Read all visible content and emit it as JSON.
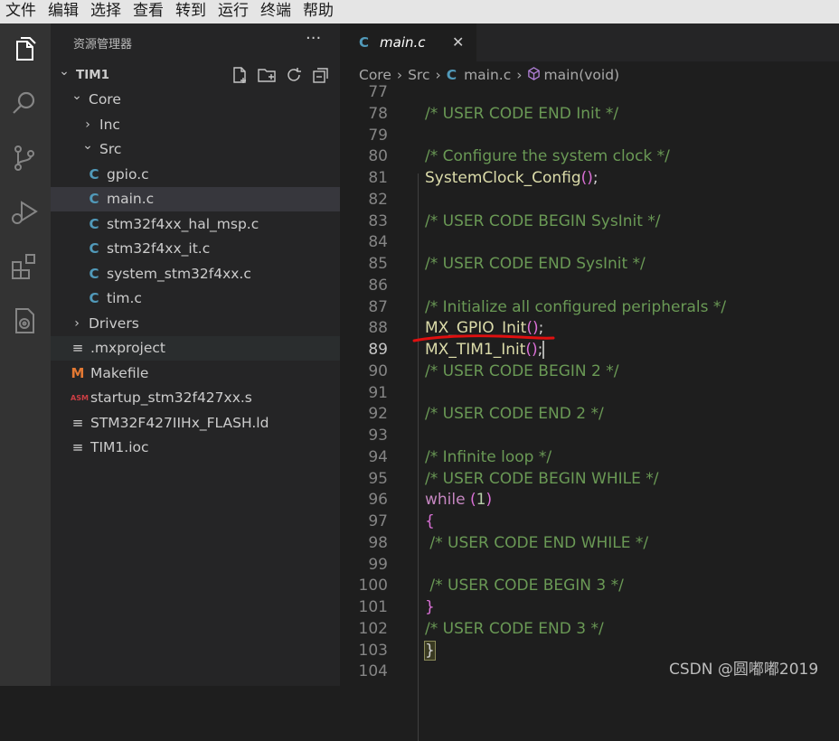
{
  "menubar": {
    "items": [
      "文件",
      "编辑",
      "选择",
      "查看",
      "转到",
      "运行",
      "终端",
      "帮助"
    ]
  },
  "activitybar": {
    "icons": [
      "files-icon",
      "search-icon",
      "source-control-icon",
      "run-debug-icon",
      "extensions-icon",
      "stm32-extension-icon"
    ]
  },
  "sidebar": {
    "title": "资源管理器",
    "more": "···",
    "tree": [
      {
        "label": "TIM1",
        "kind": "root"
      },
      {
        "label": "Core",
        "kind": "folder-open"
      },
      {
        "label": "Inc",
        "kind": "folder-closed"
      },
      {
        "label": "Src",
        "kind": "folder-open"
      },
      {
        "label": "gpio.c",
        "kind": "c"
      },
      {
        "label": "main.c",
        "kind": "c",
        "selected": true
      },
      {
        "label": "stm32f4xx_hal_msp.c",
        "kind": "c"
      },
      {
        "label": "stm32f4xx_it.c",
        "kind": "c"
      },
      {
        "label": "system_stm32f4xx.c",
        "kind": "c"
      },
      {
        "label": "tim.c",
        "kind": "c"
      },
      {
        "label": "Drivers",
        "kind": "folder-closed"
      },
      {
        "label": ".mxproject",
        "kind": "text",
        "hover": true
      },
      {
        "label": "Makefile",
        "kind": "make"
      },
      {
        "label": "startup_stm32f427xx.s",
        "kind": "asm"
      },
      {
        "label": "STM32F427IIHx_FLASH.ld",
        "kind": "text"
      },
      {
        "label": "TIM1.ioc",
        "kind": "text"
      }
    ],
    "icon_glyphs": {
      "c": "C",
      "make": "M",
      "asm": "ASM",
      "text": "≡"
    }
  },
  "editor": {
    "tab": {
      "icon": "C",
      "label": "main.c",
      "close": "✕"
    },
    "breadcrumb": {
      "parts": [
        "Core",
        "Src",
        "main.c",
        "main(void)"
      ],
      "file_icon": "C"
    },
    "lines": [
      {
        "n": "77",
        "tokens": []
      },
      {
        "n": "78",
        "tokens": [
          {
            "t": "cmt",
            "v": "/* USER CODE END Init */"
          }
        ]
      },
      {
        "n": "79",
        "tokens": []
      },
      {
        "n": "80",
        "tokens": [
          {
            "t": "cmt",
            "v": "/* Configure the system clock */"
          }
        ]
      },
      {
        "n": "81",
        "tokens": [
          {
            "t": "fn",
            "v": "SystemClock_Config"
          },
          {
            "t": "paren",
            "v": "()"
          },
          {
            "t": "punc",
            "v": ";"
          }
        ]
      },
      {
        "n": "82",
        "tokens": []
      },
      {
        "n": "83",
        "tokens": [
          {
            "t": "cmt",
            "v": "/* USER CODE BEGIN SysInit */"
          }
        ]
      },
      {
        "n": "84",
        "tokens": []
      },
      {
        "n": "85",
        "tokens": [
          {
            "t": "cmt",
            "v": "/* USER CODE END SysInit */"
          }
        ]
      },
      {
        "n": "86",
        "tokens": []
      },
      {
        "n": "87",
        "tokens": [
          {
            "t": "cmt",
            "v": "/* Initialize all configured peripherals */"
          }
        ]
      },
      {
        "n": "88",
        "tokens": [
          {
            "t": "fn",
            "v": "MX_GPIO_Init"
          },
          {
            "t": "paren",
            "v": "()"
          },
          {
            "t": "punc",
            "v": ";"
          }
        ]
      },
      {
        "n": "89",
        "active": true,
        "tokens": [
          {
            "t": "fn",
            "v": "MX_TIM1_Init"
          },
          {
            "t": "paren",
            "v": "()"
          },
          {
            "t": "punc",
            "v": ";"
          },
          {
            "t": "cursor",
            "v": ""
          }
        ]
      },
      {
        "n": "90",
        "tokens": [
          {
            "t": "cmt",
            "v": "/* USER CODE BEGIN 2 */"
          }
        ]
      },
      {
        "n": "91",
        "tokens": []
      },
      {
        "n": "92",
        "tokens": [
          {
            "t": "cmt",
            "v": "/* USER CODE END 2 */"
          }
        ]
      },
      {
        "n": "93",
        "tokens": []
      },
      {
        "n": "94",
        "tokens": [
          {
            "t": "cmt",
            "v": "/* Infinite loop */"
          }
        ]
      },
      {
        "n": "95",
        "tokens": [
          {
            "t": "cmt",
            "v": "/* USER CODE BEGIN WHILE */"
          }
        ]
      },
      {
        "n": "96",
        "tokens": [
          {
            "t": "kw",
            "v": "while"
          },
          {
            "t": "punc",
            "v": " "
          },
          {
            "t": "paren",
            "v": "("
          },
          {
            "t": "num",
            "v": "1"
          },
          {
            "t": "paren",
            "v": ")"
          }
        ]
      },
      {
        "n": "97",
        "tokens": [
          {
            "t": "paren",
            "v": "{"
          }
        ]
      },
      {
        "n": "98",
        "tokens": [
          {
            "t": "punc",
            "v": " "
          },
          {
            "t": "cmt",
            "v": "/* USER CODE END WHILE */"
          }
        ]
      },
      {
        "n": "99",
        "tokens": []
      },
      {
        "n": "100",
        "tokens": [
          {
            "t": "punc",
            "v": " "
          },
          {
            "t": "cmt",
            "v": "/* USER CODE BEGIN 3 */"
          }
        ]
      },
      {
        "n": "101",
        "tokens": [
          {
            "t": "paren",
            "v": "}"
          }
        ]
      },
      {
        "n": "102",
        "tokens": [
          {
            "t": "cmt",
            "v": "/* USER CODE END 3 */"
          }
        ]
      },
      {
        "n": "103",
        "tokens": [
          {
            "t": "brace-gold",
            "v": "}"
          }
        ]
      },
      {
        "n": "104",
        "tokens": []
      }
    ]
  },
  "annotation": {
    "underline_color": "#e01010"
  },
  "watermark": "CSDN @圆嘟嘟2019"
}
